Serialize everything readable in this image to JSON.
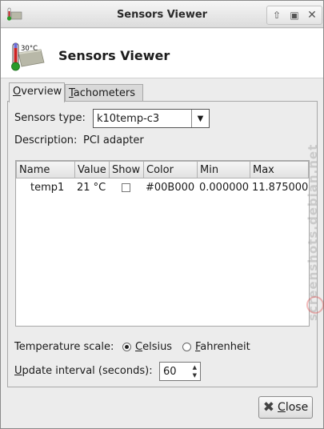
{
  "window": {
    "title": "Sensors Viewer"
  },
  "header": {
    "icon_text": "30°C",
    "title": "Sensors Viewer"
  },
  "tabs": [
    {
      "label": "Overview",
      "mnemonic": "O",
      "rest": "verview",
      "active": true
    },
    {
      "label": "Tachometers",
      "mnemonic": "T",
      "rest": "achometers",
      "active": false
    }
  ],
  "sensors": {
    "type_label": "Sensors type:",
    "type_value": "k10temp-c3",
    "description_label": "Description:",
    "description_value": "PCI adapter"
  },
  "table": {
    "columns": [
      "Name",
      "Value",
      "Show",
      "Color",
      "Min",
      "Max"
    ],
    "rows": [
      {
        "name": "temp1",
        "value": "21 °C",
        "show": false,
        "color": "#00B000",
        "min": "0.000000",
        "max": "11.875000"
      }
    ]
  },
  "scale": {
    "label": "Temperature scale:",
    "celsius_mnemonic": "C",
    "celsius_rest": "elsius",
    "fahrenheit_mnemonic": "F",
    "fahrenheit_rest": "ahrenheit",
    "selected": "Celsius"
  },
  "update": {
    "label_pre": "U",
    "label_rest": "pdate interval (seconds):",
    "value": "60"
  },
  "buttons": {
    "close_mnemonic": "C",
    "close_rest": "lose"
  },
  "watermark": {
    "text": "screenshots.debian.net"
  },
  "colors": {
    "thermometer_red": "#cc2222",
    "thermometer_green": "#2a9a2a",
    "chip_gray": "#b8b8a8"
  }
}
